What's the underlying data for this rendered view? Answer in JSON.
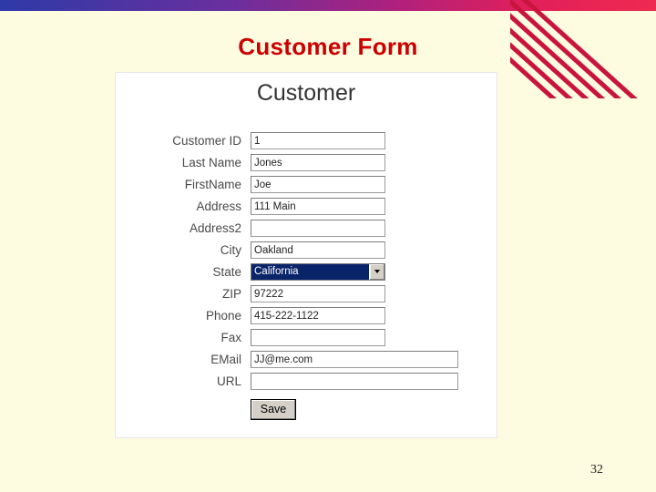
{
  "slide": {
    "title": "Customer Form",
    "page_number": "32",
    "title_color": "#cc0000",
    "background_color": "#fdfbe0"
  },
  "form": {
    "heading": "Customer",
    "rows": [
      {
        "label": "Customer ID",
        "value": "1",
        "width": "short",
        "type": "text"
      },
      {
        "label": "Last Name",
        "value": "Jones",
        "width": "short",
        "type": "text"
      },
      {
        "label": "FirstName",
        "value": "Joe",
        "width": "short",
        "type": "text"
      },
      {
        "label": "Address",
        "value": "111 Main",
        "width": "short",
        "type": "text"
      },
      {
        "label": "Address2",
        "value": "",
        "width": "short",
        "type": "text"
      },
      {
        "label": "City",
        "value": "Oakland",
        "width": "short",
        "type": "text"
      },
      {
        "label": "State",
        "value": "California",
        "width": "short",
        "type": "combo"
      },
      {
        "label": "ZIP",
        "value": "97222",
        "width": "short",
        "type": "text"
      },
      {
        "label": "Phone",
        "value": "415-222-1122",
        "width": "short",
        "type": "text"
      },
      {
        "label": "Fax",
        "value": "",
        "width": "short",
        "type": "text"
      },
      {
        "label": "EMail",
        "value": "JJ@me.com",
        "width": "long",
        "type": "text"
      },
      {
        "label": "URL",
        "value": "",
        "width": "long",
        "type": "text"
      }
    ],
    "save_label": "Save",
    "combo_selection_color": "#0a246a"
  }
}
